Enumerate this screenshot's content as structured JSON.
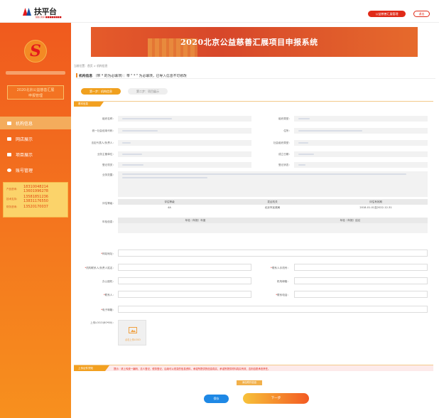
{
  "header": {
    "brand": "扶平台",
    "brand_sub": "扶贫·共享 ■■■■■■■■",
    "system_button": "公益慈善汇展管理",
    "logout_button": "退出"
  },
  "sidebar": {
    "logo_glyph": "S",
    "title_line1": "2020北京公益慈善汇展",
    "title_line2": "申报管理",
    "items": [
      {
        "label": "机构信息",
        "icon": "users-icon"
      },
      {
        "label": "网店展示",
        "icon": "store-icon"
      },
      {
        "label": "项目展示",
        "icon": "project-icon"
      },
      {
        "label": "账号管理",
        "icon": "gear-icon"
      }
    ],
    "contacts": [
      {
        "key": "产品咨询：",
        "values": [
          "18310048214",
          "13601996278"
        ]
      },
      {
        "key": "技术支持：",
        "values": [
          "13581851236",
          "13831176550"
        ]
      },
      {
        "key": "财务咨询：",
        "values": [
          "13520170037"
        ]
      }
    ]
  },
  "banner": {
    "title": "2020北京公益慈善汇展项目申报系统"
  },
  "breadcrumb": "当前位置：首页 > 机构信息",
  "panel": {
    "title": "机构信息",
    "hint": "（带 * 的为必填项）：带 \" * \" 为必填项，已导入信息不可修改"
  },
  "steps": {
    "step1": "第一步：机构信息",
    "step2": "第二步：项目展示"
  },
  "section_basic": "基本信息",
  "basic_fields": {
    "org_name": "组织名称：",
    "credit_code": "统一社会信用代码：",
    "legal_rep": "法定代表人/负责人：",
    "authority": "业务主管单位：",
    "reg_date": "登记机关：",
    "scope": "业务范围：",
    "org_type": "组织类型：",
    "address": "住所：",
    "org_form": "社会组织类型：",
    "found_date": "成立日期：",
    "status": "登记状态："
  },
  "evaluation": {
    "label": "评估等级：",
    "headers": [
      "评估等级",
      "发证机关",
      "评估有效期"
    ],
    "row": [
      "4A",
      "北京市民政局",
      "2018-01-01至2022-12-31"
    ]
  },
  "annual": {
    "label": "年检信息：",
    "headers": [
      "年检（年报）年度",
      "年检（年报）结论"
    ]
  },
  "form": {
    "website": "网站地址：",
    "contact_person": "机构联系人/负责人姓名：",
    "contact_phone": "联系人手机号：",
    "office_phone": "办公座机：",
    "email": "机构邮箱：",
    "contact": "联系人：",
    "phone": "联系电话：",
    "email2": "电子邮箱：",
    "logo": "上传LOGO(80*80)：",
    "upload_hint": "点击上传LOGO"
  },
  "note": {
    "tag": "上传证件须知",
    "text": "提示：请上传统一编码、法人登记、税务登记、后续可以改变的信息资料，承诺所提供的信息真实、承诺所提供材料真实有效，否则自愿承担责任。"
  },
  "attach_button": "添加附件信息",
  "save_button": "保存",
  "next_button": "下一步",
  "colors": {
    "accent": "#f08a24",
    "danger": "#e02a18",
    "primary": "#1e88e5"
  }
}
